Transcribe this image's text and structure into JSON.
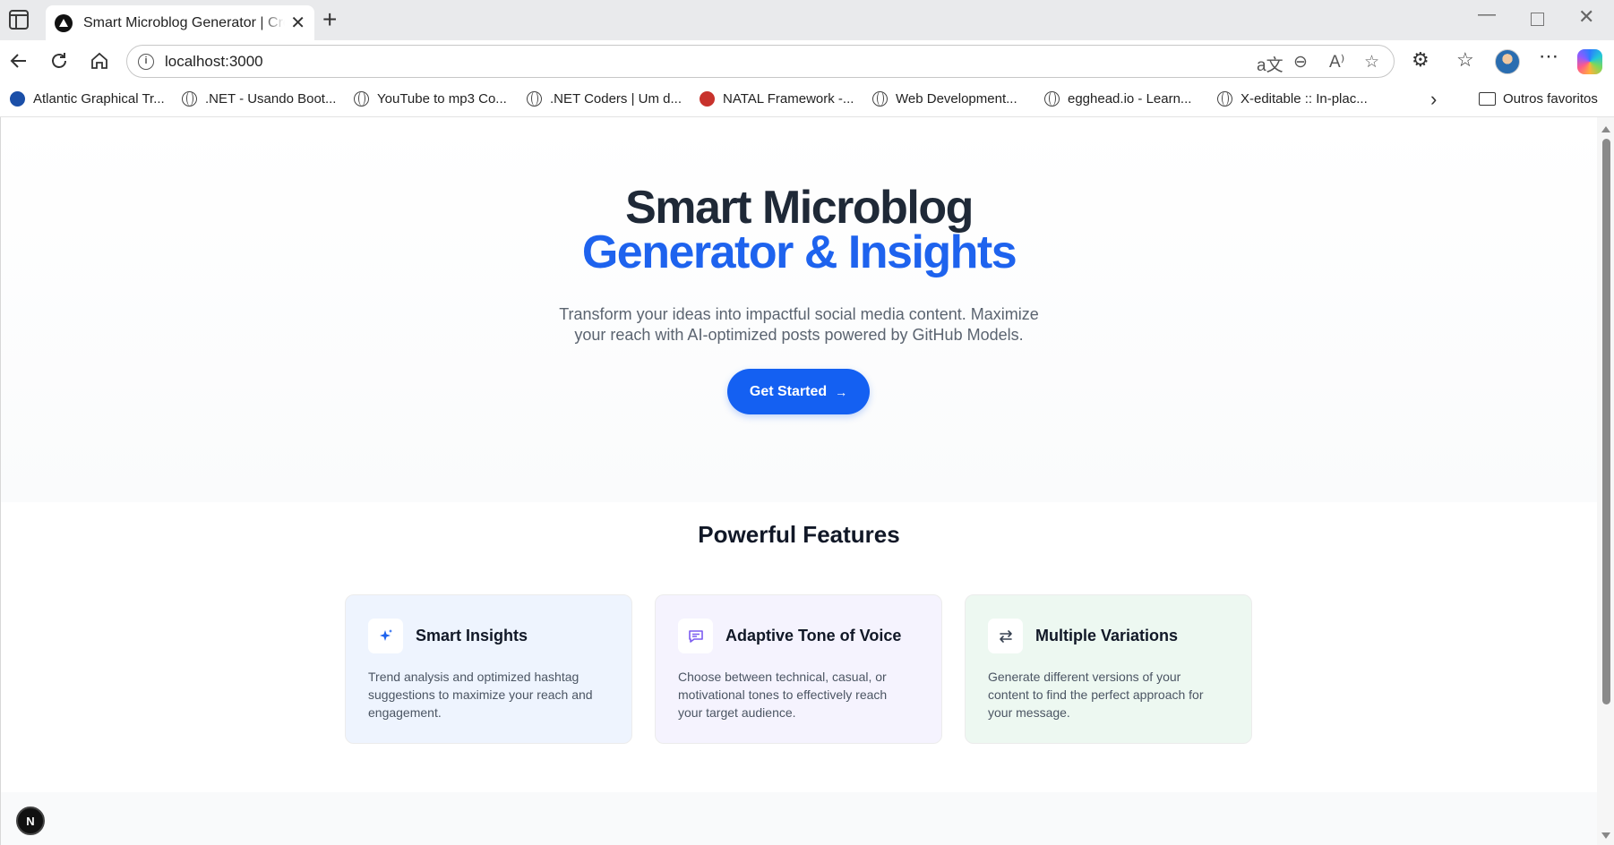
{
  "browser": {
    "tab_title": "Smart Microblog Generator | Create",
    "url": "localhost:3000",
    "bookmarks": [
      {
        "label": "Atlantic Graphical Tr...",
        "icon": "noaa-icon"
      },
      {
        "label": ".NET - Usando Boot...",
        "icon": "globe-icon"
      },
      {
        "label": "YouTube to mp3 Co...",
        "icon": "globe-icon"
      },
      {
        "label": ".NET Coders | Um d...",
        "icon": "globe-icon"
      },
      {
        "label": "NATAL Framework -...",
        "icon": "natal-icon"
      },
      {
        "label": "Web Development...",
        "icon": "globe-icon"
      },
      {
        "label": "egghead.io - Learn...",
        "icon": "egghead-icon"
      },
      {
        "label": "X-editable :: In-plac...",
        "icon": "globe-icon"
      }
    ],
    "other_favorites": "Outros favoritos"
  },
  "hero": {
    "title_line1": "Smart Microblog",
    "title_line2": "Generator & Insights",
    "subtitle_line1": "Transform your ideas into impactful social media content. Maximize",
    "subtitle_line2": "your reach with AI-optimized posts powered by GitHub Models.",
    "cta_label": "Get Started",
    "accent_color": "#1e63ee"
  },
  "features": {
    "heading": "Powerful Features",
    "cards": [
      {
        "title": "Smart Insights",
        "icon": "sparkles-icon",
        "text_lines": [
          "Trend analysis and optimized hashtag",
          "suggestions to maximize your reach and",
          "engagement."
        ],
        "bg_color": "#eef4fe"
      },
      {
        "title": "Adaptive Tone of Voice",
        "icon": "message-icon",
        "text_lines": [
          "Choose between technical, casual, or",
          "motivational tones to effectively reach",
          "your target audience."
        ],
        "bg_color": "#f5f3fe"
      },
      {
        "title": "Multiple Variations",
        "icon": "swap-arrows-icon",
        "text_lines": [
          "Generate different versions of your",
          "content to find the perfect approach for",
          "your message."
        ],
        "bg_color": "#edf8f1"
      }
    ]
  },
  "dev_badge": "N"
}
